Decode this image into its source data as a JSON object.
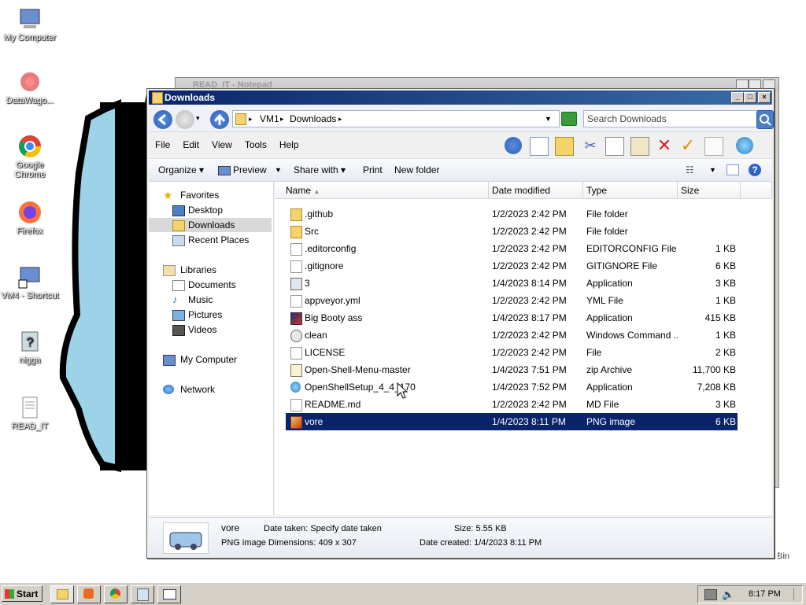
{
  "desktop": {
    "icons": [
      {
        "label": "My Computer",
        "icon": "computer-icon"
      },
      {
        "label": "DataWago...",
        "icon": "datawago-icon"
      },
      {
        "label": "Google Chrome",
        "icon": "chrome-icon"
      },
      {
        "label": "Firefox",
        "icon": "firefox-icon"
      },
      {
        "label": "VM4 - Shortcut",
        "icon": "vm-shortcut-icon"
      },
      {
        "label": "nigga",
        "icon": "unknown-file-icon"
      },
      {
        "label": "READ_IT",
        "icon": "text-file-icon"
      }
    ],
    "recycle_label_partial": "Bin"
  },
  "notepad": {
    "title": "READ_IT - Notepad"
  },
  "explorer": {
    "title": "Downloads",
    "breadcrumb": [
      "VM1",
      "Downloads"
    ],
    "search_placeholder": "Search Downloads",
    "menu": [
      "File",
      "Edit",
      "View",
      "Tools",
      "Help"
    ],
    "commands": {
      "organize": "Organize",
      "preview": "Preview",
      "share_with": "Share with",
      "print": "Print",
      "new_folder": "New folder"
    },
    "nav": {
      "favorites": "Favorites",
      "desktop": "Desktop",
      "downloads": "Downloads",
      "recent": "Recent Places",
      "libraries": "Libraries",
      "documents": "Documents",
      "music": "Music",
      "pictures": "Pictures",
      "videos": "Videos",
      "my_computer": "My Computer",
      "network": "Network"
    },
    "columns": {
      "name": "Name",
      "date": "Date modified",
      "type": "Type",
      "size": "Size"
    },
    "files": [
      {
        "name": ".github",
        "date": "1/2/2023 2:42 PM",
        "type": "File folder",
        "size": "",
        "icon": "folder-icon"
      },
      {
        "name": "Src",
        "date": "1/2/2023 2:42 PM",
        "type": "File folder",
        "size": "",
        "icon": "folder-icon"
      },
      {
        "name": ".editorconfig",
        "date": "1/2/2023 2:42 PM",
        "type": "EDITORCONFIG File",
        "size": "1 KB",
        "icon": "file-icon"
      },
      {
        "name": ".gitignore",
        "date": "1/2/2023 2:42 PM",
        "type": "GITIGNORE File",
        "size": "6 KB",
        "icon": "file-icon"
      },
      {
        "name": "3",
        "date": "1/4/2023 8:14 PM",
        "type": "Application",
        "size": "3 KB",
        "icon": "app-icon"
      },
      {
        "name": "appveyor.yml",
        "date": "1/2/2023 2:42 PM",
        "type": "YML File",
        "size": "1 KB",
        "icon": "file-icon"
      },
      {
        "name": "Big Booty ass",
        "date": "1/4/2023 8:17 PM",
        "type": "Application",
        "size": "415 KB",
        "icon": "app-image-icon"
      },
      {
        "name": "clean",
        "date": "1/2/2023 2:42 PM",
        "type": "Windows Command ...",
        "size": "1 KB",
        "icon": "cmd-icon"
      },
      {
        "name": "LICENSE",
        "date": "1/2/2023 2:42 PM",
        "type": "File",
        "size": "2 KB",
        "icon": "file-icon"
      },
      {
        "name": "Open-Shell-Menu-master",
        "date": "1/4/2023 7:51 PM",
        "type": "zip Archive",
        "size": "11,700 KB",
        "icon": "zip-icon"
      },
      {
        "name": "OpenShellSetup_4_4_170",
        "date": "1/4/2023 7:52 PM",
        "type": "Application",
        "size": "7,208 KB",
        "icon": "shell-icon"
      },
      {
        "name": "README.md",
        "date": "1/2/2023 2:42 PM",
        "type": "MD File",
        "size": "3 KB",
        "icon": "file-icon"
      },
      {
        "name": "vore",
        "date": "1/4/2023 8:11 PM",
        "type": "PNG image",
        "size": "6 KB",
        "icon": "png-icon"
      }
    ],
    "details": {
      "name": "vore",
      "date_taken": "Date taken: Specify date taken",
      "size": "Size: 5.55 KB",
      "type_dims": "PNG image Dimensions: 409 x 307",
      "date_created": "Date created: 1/4/2023 8:11 PM"
    }
  },
  "taskbar": {
    "start": "Start",
    "clock": "8:17 PM"
  }
}
